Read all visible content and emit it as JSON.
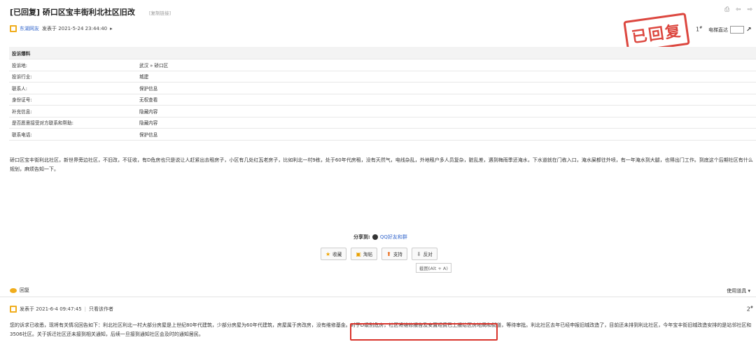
{
  "thread": {
    "title": "[已回复] 硚口区宝丰街利北社区旧改",
    "copy_link": "[复制链接]",
    "top_icons": "⎙ ⇦ ⇨"
  },
  "post1": {
    "author": "东湖网友",
    "posted_at": "发表于 2021-5-24 23:44:40",
    "expand": "▸",
    "stamp": "已回复",
    "floor": "1",
    "floor_mark": "#",
    "jump_label": "电梯直达",
    "info_header": "投诉爆料",
    "info_rows": [
      {
        "k": "投诉地:",
        "v": "武汉 » 硚口区"
      },
      {
        "k": "投诉行业:",
        "v": "城建"
      },
      {
        "k": "联系人:",
        "v": "保护信息"
      },
      {
        "k": "身份证号:",
        "v": "无权查看"
      },
      {
        "k": "补充信息:",
        "v": "隐藏内容"
      },
      {
        "k": "是否愿意接受对方联系和帮助:",
        "v": "隐藏内容"
      },
      {
        "k": "联系电话:",
        "v": "保护信息"
      }
    ],
    "body": "硚口区宝丰街利北社区，新世界旁边社区，不旧改，不征收，有D危房也只是说让人赶紧出去租房子，小区有几处红瓦老房子，比如利北一村9栋，处于60年代房租，没有天然气，电线杂乱，外地租户多人员复杂，脏乱差，遇到梅雨季还淹水，下水道就在门栋入口，淹水屎都往外喷，有一年淹水到大腿，也得出门工作。到底这个后期社区有什么规划，麻烦告知一下。",
    "share_label": "分享到:",
    "share_target": "QQ好友和群",
    "buttons": {
      "favorite": "收藏",
      "post": "淘帖",
      "support": "支持",
      "oppose": "反对"
    },
    "tooltip": "截图(Alt + A)"
  },
  "reply_bar": {
    "reply": "回复",
    "tools": "使用道具 ▾"
  },
  "post2": {
    "posted_at": "发表于 2021-6-4 09:47:45",
    "sep": "|",
    "author_only": "只看该作者",
    "floor": "2",
    "floor_mark": "#",
    "body": "您的诉求已收悉，现将有关情况回告如下：利北社区利北一村大部分房屋是上世纪80年代建筑，少部分房屋为60年代建筑，房屋属于房改房，没有维修基金。对于D级别危房，社区将维修报告及安置经费已上报给区房地局和街道，等待审批。利北社区去年已经申报旧城改造了，目前还未排到利北社区，今年宝丰街旧城改造安排的是站邻社区和3506社区。关于拆迁社区还未接到相关通知，后续一旦接到通知社区会及时的通知居民。"
  },
  "colors": {
    "stamp_red": "#d9342b",
    "avatar_orange": "#f0ad1d",
    "link_blue": "#3366cc"
  }
}
